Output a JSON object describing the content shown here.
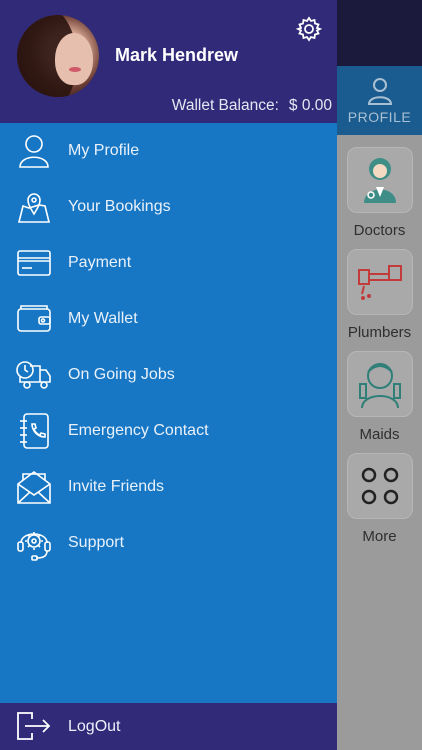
{
  "background": {
    "profile_tab_label": "PROFILE",
    "services": [
      {
        "label": "Doctors",
        "icon": "doctor-icon"
      },
      {
        "label": "Plumbers",
        "icon": "plumber-icon"
      },
      {
        "label": "Maids",
        "icon": "maid-icon"
      },
      {
        "label": "More",
        "icon": "more-grid-icon"
      }
    ]
  },
  "drawer": {
    "user_name": "Mark Hendrew",
    "wallet_label": "Wallet Balance:",
    "wallet_value": "$ 0.00",
    "menu": [
      {
        "label": "My Profile",
        "icon": "user-icon"
      },
      {
        "label": "Your Bookings",
        "icon": "map-pin-icon"
      },
      {
        "label": "Payment",
        "icon": "credit-card-icon"
      },
      {
        "label": "My Wallet",
        "icon": "wallet-icon"
      },
      {
        "label": "On Going Jobs",
        "icon": "delivery-truck-icon"
      },
      {
        "label": "Emergency Contact",
        "icon": "phone-book-icon"
      },
      {
        "label": "Invite Friends",
        "icon": "envelope-icon"
      },
      {
        "label": "Support",
        "icon": "support-headset-icon"
      }
    ],
    "logout_label": "LogOut"
  },
  "colors": {
    "drawer_bg": "#1777c4",
    "header_bg": "#302a78",
    "overlay_bg": "#9b9b9b"
  }
}
